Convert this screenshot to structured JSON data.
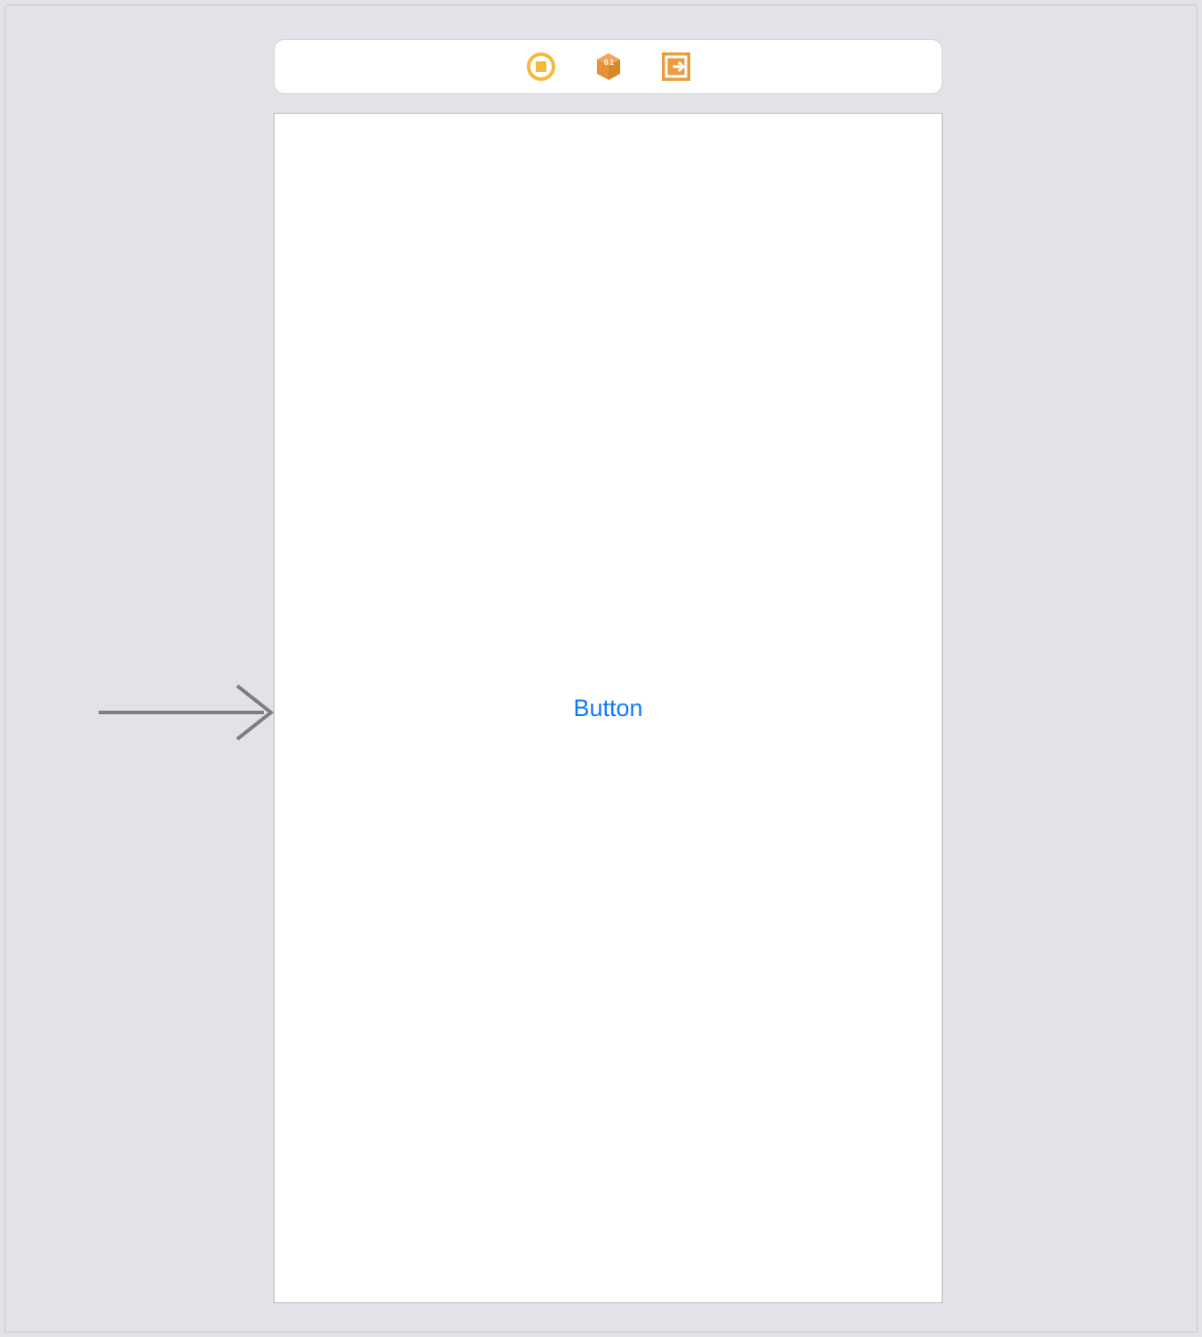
{
  "toolbar": {
    "icons": {
      "stop": "stop-icon",
      "box": "box-icon",
      "embed": "embed-icon"
    },
    "colors": {
      "yellow": "#f5b93b",
      "orange": "#e69138",
      "orange_fill": "#ea9d3e"
    }
  },
  "canvas": {
    "button": {
      "label": "Button",
      "color": "#0b7aff"
    }
  },
  "annotations": {
    "arrow_color": "#7e7e7e"
  }
}
